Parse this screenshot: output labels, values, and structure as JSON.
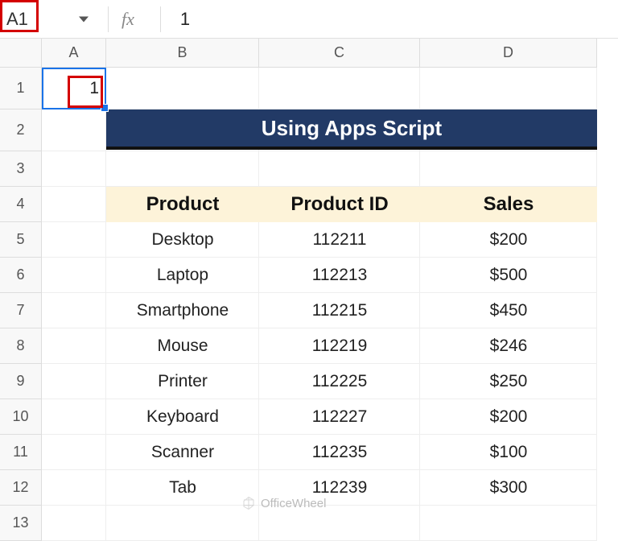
{
  "formula_bar": {
    "cell_ref": "A1",
    "fx_label": "fx",
    "value": "1"
  },
  "columns": [
    "A",
    "B",
    "C",
    "D"
  ],
  "rows": [
    "1",
    "2",
    "3",
    "4",
    "5",
    "6",
    "7",
    "8",
    "9",
    "10",
    "11",
    "12",
    "13"
  ],
  "a1_value": "1",
  "title": "Using Apps Script",
  "headers": {
    "b": "Product",
    "c": "Product ID",
    "d": "Sales"
  },
  "products": [
    {
      "name": "Desktop",
      "id": "112211",
      "sales": "$200"
    },
    {
      "name": "Laptop",
      "id": "112213",
      "sales": "$500"
    },
    {
      "name": "Smartphone",
      "id": "112215",
      "sales": "$450"
    },
    {
      "name": "Mouse",
      "id": "112219",
      "sales": "$246"
    },
    {
      "name": "Printer",
      "id": "112225",
      "sales": "$250"
    },
    {
      "name": "Keyboard",
      "id": "112227",
      "sales": "$200"
    },
    {
      "name": "Scanner",
      "id": "112235",
      "sales": "$100"
    },
    {
      "name": "Tab",
      "id": "112239",
      "sales": "$300"
    }
  ],
  "watermark": "OfficeWheel",
  "chart_data": {
    "type": "table",
    "title": "Using Apps Script",
    "columns": [
      "Product",
      "Product ID",
      "Sales"
    ],
    "rows": [
      [
        "Desktop",
        112211,
        200
      ],
      [
        "Laptop",
        112213,
        500
      ],
      [
        "Smartphone",
        112215,
        450
      ],
      [
        "Mouse",
        112219,
        246
      ],
      [
        "Printer",
        112225,
        250
      ],
      [
        "Keyboard",
        112227,
        200
      ],
      [
        "Scanner",
        112235,
        100
      ],
      [
        "Tab",
        112239,
        300
      ]
    ]
  }
}
